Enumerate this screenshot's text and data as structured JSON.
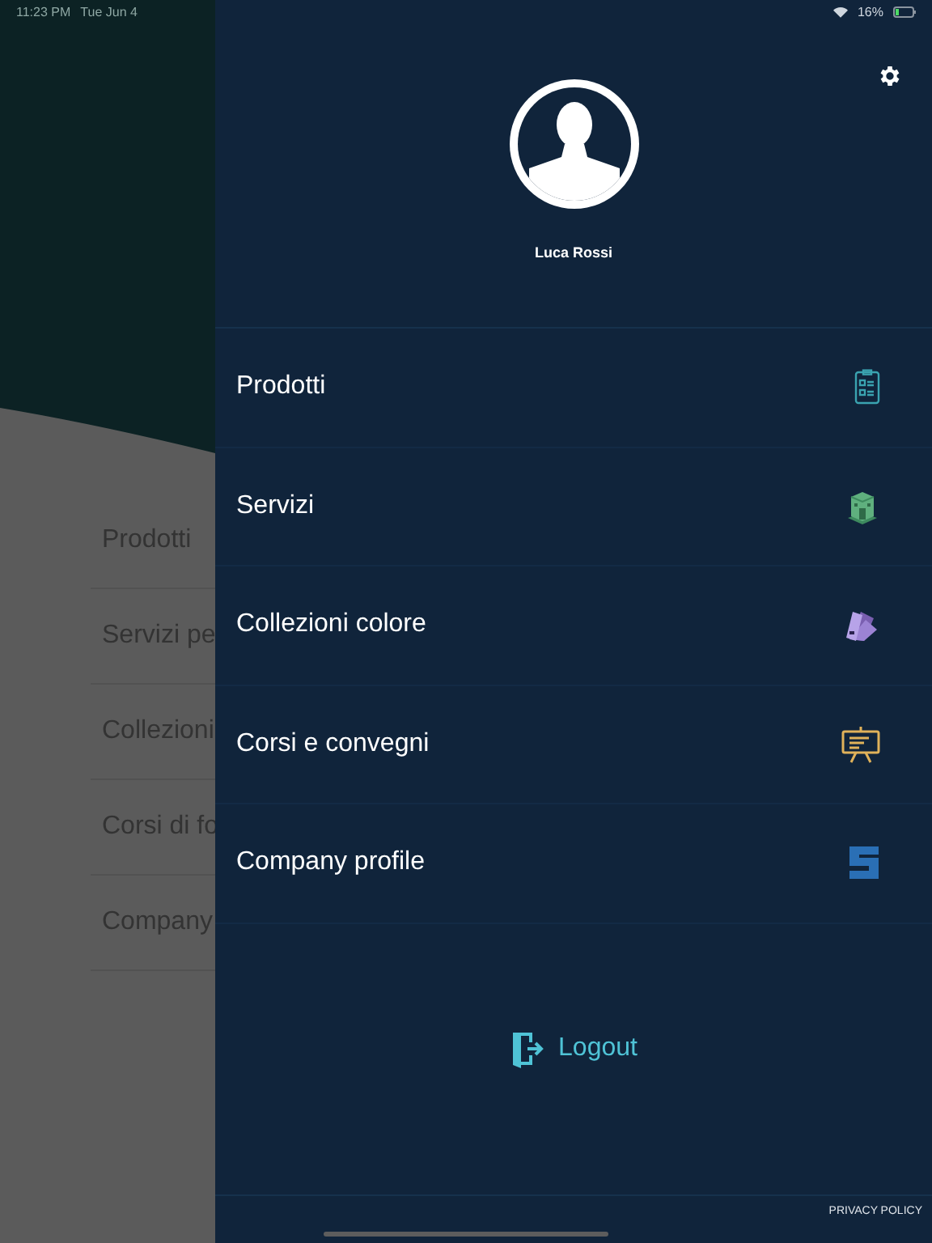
{
  "status_bar": {
    "time": "11:23 PM",
    "date": "Tue Jun 4",
    "battery": "16%"
  },
  "background_menu": {
    "items": [
      "Prodotti",
      "Servizi pe",
      "Collezioni",
      "Corsi di fo",
      "Company"
    ]
  },
  "drawer": {
    "user_name": "Luca Rossi",
    "items": [
      {
        "label": "Prodotti"
      },
      {
        "label": "Servizi"
      },
      {
        "label": "Collezioni colore"
      },
      {
        "label": "Corsi e convegni"
      },
      {
        "label": "Company profile"
      }
    ],
    "logout": "Logout",
    "privacy_policy": "PRIVACY POLICY"
  }
}
